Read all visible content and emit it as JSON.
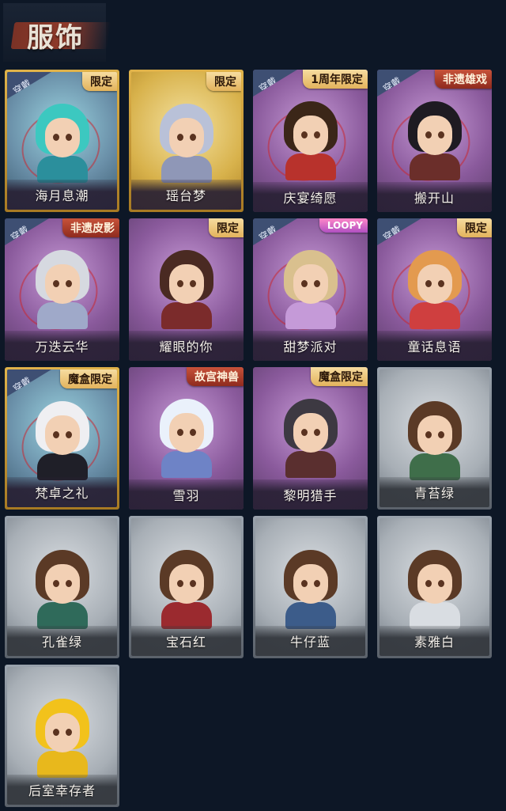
{
  "header": {
    "title": "服饰"
  },
  "equip_label": "穿戴",
  "cards": [
    {
      "name": "海月息潮",
      "tag": "限定",
      "equipped": true,
      "style": "gold",
      "hair": "#3cc8c0",
      "body": "#2b8f9c"
    },
    {
      "name": "瑶台梦",
      "tag": "限定",
      "equipped": false,
      "style": "gold bright",
      "hair": "#b9c1d8",
      "body": "#8f97b7"
    },
    {
      "name": "庆宴绮愿",
      "tag": "1周年限定",
      "equipped": true,
      "style": "purple",
      "hair": "#3b2618",
      "body": "#b8322c"
    },
    {
      "name": "搬开山",
      "tag": "非遗雄戏",
      "equipped": true,
      "style": "purple",
      "hair": "#1e1b22",
      "body": "#6b2e2a"
    },
    {
      "name": "万迭云华",
      "tag": "非遗皮影",
      "equipped": true,
      "style": "purple",
      "hair": "#d6d9e0",
      "body": "#9fa9c9"
    },
    {
      "name": "耀眼的你",
      "tag": "限定",
      "equipped": false,
      "style": "purple",
      "hair": "#4a2a22",
      "body": "#7b2b2b"
    },
    {
      "name": "甜梦派对",
      "tag": "LOOPY",
      "equipped": true,
      "style": "purple",
      "hair": "#d9c08e",
      "body": "#c59ad8"
    },
    {
      "name": "童话息语",
      "tag": "限定",
      "equipped": true,
      "style": "purple",
      "hair": "#e39a4f",
      "body": "#cf3f3f"
    },
    {
      "name": "梵卓之礼",
      "tag": "魔盒限定",
      "equipped": true,
      "style": "gold",
      "hair": "#efeff2",
      "body": "#1f1f28"
    },
    {
      "name": "雪羽",
      "tag": "故宫神兽",
      "equipped": false,
      "style": "purple",
      "hair": "#eaf1fb",
      "body": "#6e83c6"
    },
    {
      "name": "黎明猎手",
      "tag": "魔盒限定",
      "equipped": false,
      "style": "purple",
      "hair": "#3d3942",
      "body": "#5a2f2f"
    },
    {
      "name": "青苔绿",
      "tag": "",
      "equipped": false,
      "style": "silver",
      "hair": "#5b3a26",
      "body": "#3f6e4a"
    },
    {
      "name": "孔雀绿",
      "tag": "",
      "equipped": false,
      "style": "silver",
      "hair": "#5b3a26",
      "body": "#2f6a5a"
    },
    {
      "name": "宝石红",
      "tag": "",
      "equipped": false,
      "style": "silver",
      "hair": "#5b3a26",
      "body": "#9b2a2f"
    },
    {
      "name": "牛仔蓝",
      "tag": "",
      "equipped": false,
      "style": "silver",
      "hair": "#5b3a26",
      "body": "#3c5c8a"
    },
    {
      "name": "素雅白",
      "tag": "",
      "equipped": false,
      "style": "silver",
      "hair": "#5b3a26",
      "body": "#d9dde2"
    },
    {
      "name": "后室幸存者",
      "tag": "",
      "equipped": false,
      "style": "silver",
      "hair": "#f2c21b",
      "body": "#e8b81c"
    }
  ]
}
